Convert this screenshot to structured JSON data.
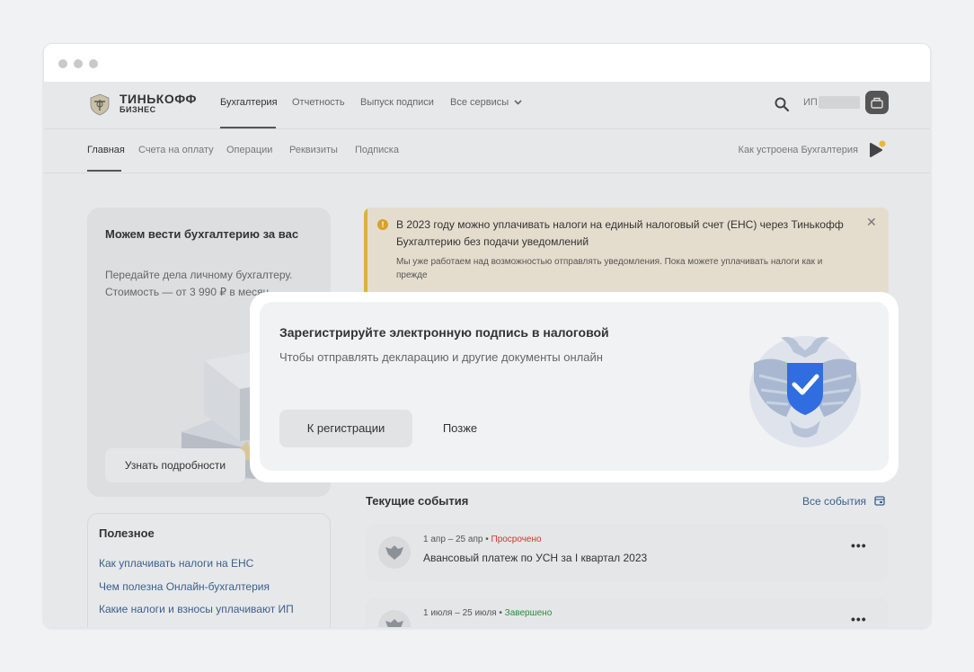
{
  "header": {
    "logo_line1": "ТИНЬКОФФ",
    "logo_line2": "БИЗНЕС",
    "nav": [
      {
        "label": "Бухгалтерия",
        "active": true
      },
      {
        "label": "Отчетность"
      },
      {
        "label": "Выпуск подписи"
      },
      {
        "label": "Все сервисы"
      }
    ],
    "user_prefix": "ИП"
  },
  "subnav": {
    "items": [
      {
        "label": "Главная",
        "active": true
      },
      {
        "label": "Счета на оплату"
      },
      {
        "label": "Операции"
      },
      {
        "label": "Реквизиты"
      },
      {
        "label": "Подписка"
      }
    ],
    "howto": "Как устроена Бухгалтерия"
  },
  "promo": {
    "title": "Можем вести бухгалтерию за вас",
    "desc": "Передайте дела личному бухгалтеру. Стоимость — от 3 990 ₽ в месяц",
    "button": "Узнать подробности"
  },
  "useful": {
    "title": "Полезное",
    "links": [
      "Как уплачивать налоги на ЕНС",
      "Чем полезна Онлайн-бухгалтерия",
      "Какие налоги и взносы уплачивают ИП"
    ]
  },
  "alert": {
    "icon": "!",
    "title": "В 2023 году можно уплачивать налоги на единый налоговый счет (ЕНС) через Тинькофф Бухгалтерию без подачи уведомлений",
    "text": "Мы уже работаем над возможностью отправлять уведомления. Пока можете уплачивать налоги как и прежде",
    "close": "✕"
  },
  "events": {
    "title": "Текущие события",
    "all_label": "Все события",
    "items": [
      {
        "dates": "1 апр – 25 апр",
        "status": "Просрочено",
        "title": "Авансовый платеж по УСН за I квартал 2023"
      },
      {
        "dates": "1 июля – 25 июля",
        "status": "Завершено",
        "title": ""
      }
    ],
    "menu": "•••",
    "separator": " • "
  },
  "modal": {
    "title": "Зарегистрируйте электронную подпись в налоговой",
    "text": "Чтобы отправлять декларацию и другие документы онлайн",
    "primary_button": "К регистрации",
    "secondary_button": "Позже"
  },
  "icons": {
    "search": "search-icon",
    "chevron": "chevron-down-icon",
    "play": "play-icon",
    "calendar": "calendar-icon",
    "emblem": "eagle-emblem-icon",
    "shield": "shield-check-icon"
  },
  "colors": {
    "link": "#3d5f8a",
    "overdue": "#c53a2e",
    "done": "#2e8b3e",
    "alert_accent": "#d9b240"
  }
}
